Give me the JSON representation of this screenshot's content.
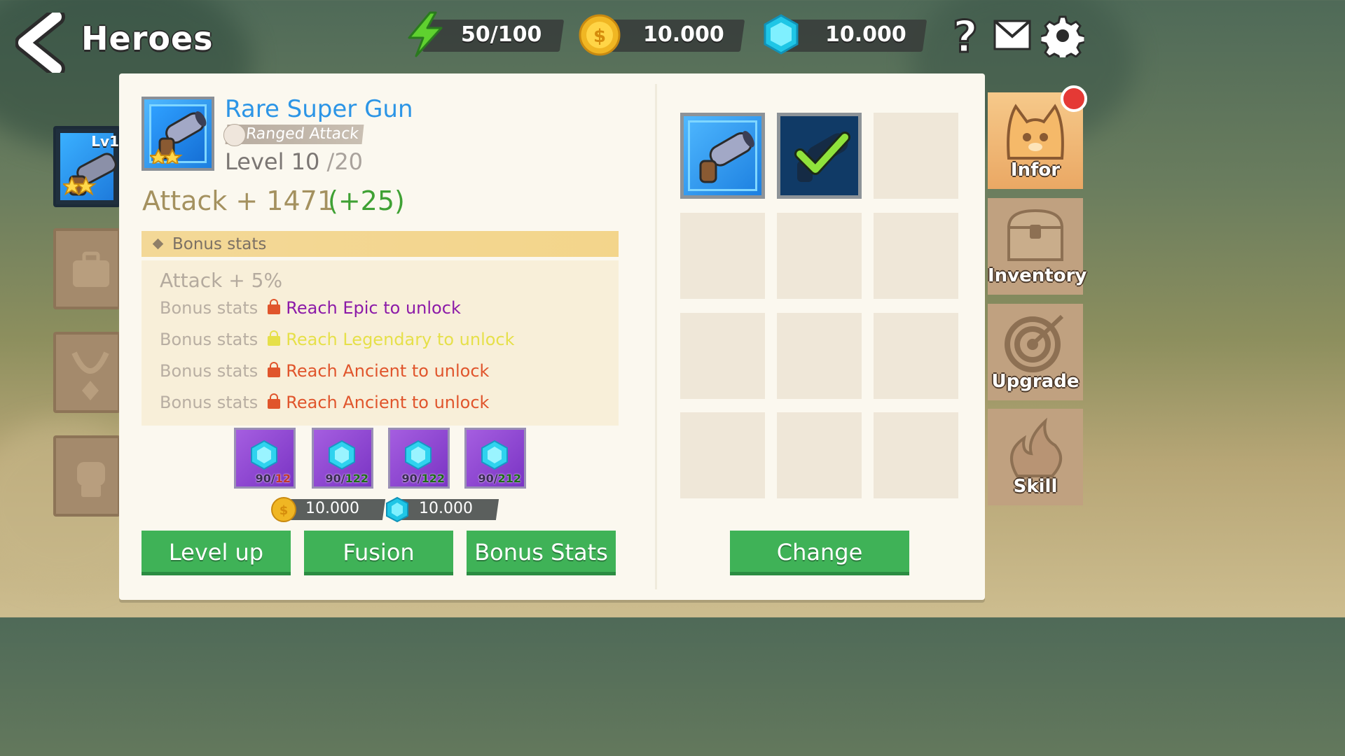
{
  "header": {
    "title": "Heroes",
    "energy": "50/100",
    "coins": "10.000",
    "gems": "10.000",
    "icons": [
      "back-arrow-icon",
      "lightning-icon",
      "coin-icon",
      "gem-icon",
      "help-icon",
      "mail-icon",
      "gear-icon"
    ]
  },
  "left_strip": {
    "hero_level_label": "Lv1",
    "icons": [
      "cannon-icon",
      "bag-icon",
      "necklace-icon",
      "fist-icon"
    ]
  },
  "item": {
    "name": "Rare Super Gun",
    "type": "Ranged Attack",
    "level": "Level 10",
    "max_level": "/20",
    "attack": "Attack + 1471",
    "attack_bonus": "(+25)"
  },
  "bonus": {
    "header": "Bonus stats",
    "first": "Attack + 5%",
    "rows": [
      {
        "label": "Bonus stats",
        "msg": "Reach Epic to unlock",
        "color": "#8c1aa8"
      },
      {
        "label": "Bonus stats",
        "msg": "Reach Legendary to unlock",
        "color": "#e6e04a"
      },
      {
        "label": "Bonus stats",
        "msg": "Reach Ancient to unlock",
        "color": "#e0552c"
      },
      {
        "label": "Bonus stats",
        "msg": "Reach Ancient to unlock",
        "color": "#e0552c"
      }
    ]
  },
  "gems": [
    {
      "have": "90/",
      "need": "12"
    },
    {
      "have": "90/",
      "need": "122"
    },
    {
      "have": "90/",
      "need": "122"
    },
    {
      "have": "90/",
      "need": "212"
    }
  ],
  "costs": {
    "coin": "10.000",
    "gem": "10.000"
  },
  "buttons": {
    "level_up": "Level up",
    "fusion": "Fusion",
    "bonus_stats": "Bonus Stats",
    "change": "Change"
  },
  "tabs": [
    {
      "label": "Infor",
      "icon": "cat-face-icon"
    },
    {
      "label": "Inventory",
      "icon": "chest-icon"
    },
    {
      "label": "Upgrade",
      "icon": "target-icon"
    },
    {
      "label": "Skill",
      "icon": "flame-icon"
    }
  ],
  "colors": {
    "accent_green": "#3fb257",
    "item_name_blue": "#2c95e6",
    "attack_gold": "#a4915f",
    "bonus_green": "#3fa134"
  }
}
